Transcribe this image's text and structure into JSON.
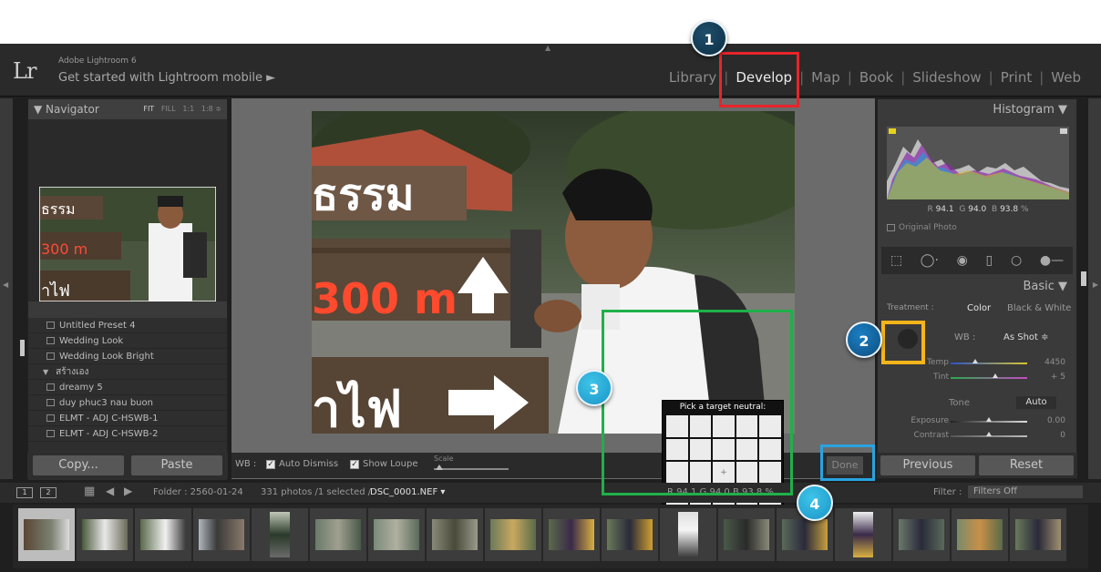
{
  "header": {
    "logo": "Lr",
    "brand": "Adobe Lightroom 6",
    "mobile_link": "Get started with Lightroom mobile ►",
    "modules": [
      "Library",
      "Develop",
      "Map",
      "Book",
      "Slideshow",
      "Print",
      "Web"
    ],
    "active_module": "Develop"
  },
  "navigator": {
    "title": "▼ Navigator",
    "zoom_fit": "FIT",
    "zoom_fill": "FILL",
    "zoom_1_1": "1:1",
    "zoom_1_8": "1:8 ≑"
  },
  "presets": [
    {
      "label": "Untitled Preset 4",
      "kind": "item"
    },
    {
      "label": "Wedding Look",
      "kind": "item"
    },
    {
      "label": "Wedding Look Bright",
      "kind": "item"
    },
    {
      "label": "สร้างเอง",
      "kind": "folder"
    },
    {
      "label": "dreamy 5",
      "kind": "item"
    },
    {
      "label": "duy phuc3 nau buon",
      "kind": "item"
    },
    {
      "label": "ELMT - ADJ C-HSWB-1",
      "kind": "item"
    },
    {
      "label": "ELMT - ADJ C-HSWB-2",
      "kind": "item"
    }
  ],
  "left_buttons": {
    "copy": "Copy...",
    "paste": "Paste"
  },
  "toolbar": {
    "wb_label": "WB :",
    "auto_dismiss": "Auto Dismiss",
    "show_loupe": "Show Loupe",
    "scale_label": "Scale",
    "done": "Done"
  },
  "loupe": {
    "title": "Pick a target neutral:",
    "center_mark": "+"
  },
  "histogram": {
    "title": "Histogram ▼",
    "r_label": "R",
    "r_value": "94.1",
    "g_label": "G",
    "g_value": "94.0",
    "b_label": "B",
    "b_value": "93.8",
    "unit": "%",
    "original_photo": "Original Photo"
  },
  "basic": {
    "title": "Basic ▼",
    "treatment_label": "Treatment :",
    "treatment_color": "Color",
    "treatment_bw": "Black & White",
    "wb_label": "WB :",
    "wb_value": "As Shot ≑",
    "temp_label": "Temp",
    "temp_value": "4450",
    "tint_label": "Tint",
    "tint_value": "+ 5",
    "tone_label": "Tone",
    "auto_label": "Auto",
    "exposure_label": "Exposure",
    "exposure_value": "0.00",
    "contrast_label": "Contrast",
    "contrast_value": "0"
  },
  "right_buttons": {
    "previous": "Previous",
    "reset": "Reset"
  },
  "filmstrip_header": {
    "view1": "1",
    "view2": "2",
    "folder": "Folder : 2560-01-24",
    "count": "331 photos /1 selected /",
    "filename": "DSC_0001.NEF ▾",
    "readout": "R 94.1   G 94.0   B 93.8 %",
    "filter_label": "Filter :",
    "filter_value": "Filters Off"
  },
  "callouts": [
    "1",
    "2",
    "3",
    "4"
  ],
  "colors": {
    "red_highlight": "#e8242a",
    "yellow_highlight": "#f5b51a",
    "green_highlight": "#1fb04a",
    "blue_highlight": "#29a3e0"
  },
  "photo": {
    "sign_text_top": "ธรรม",
    "sign_text_mid": "300 m",
    "sign_text_bottom": "าไฟ"
  }
}
